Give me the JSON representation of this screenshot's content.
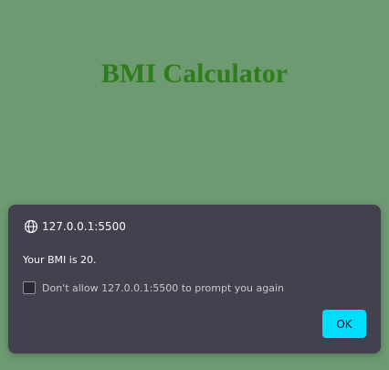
{
  "page": {
    "title": "BMI Calculator",
    "background_color": "#6e9a72",
    "title_color": "#2e7d1a"
  },
  "dialog": {
    "origin": "127.0.0.1:5500",
    "origin_icon": "globe-icon",
    "message": "Your BMI is 20.",
    "checkbox_label": "Don't allow 127.0.0.1:5500 to prompt you again",
    "checkbox_checked": false,
    "ok_label": "OK",
    "background_color": "#42414d",
    "accent_color": "#00ddff"
  }
}
